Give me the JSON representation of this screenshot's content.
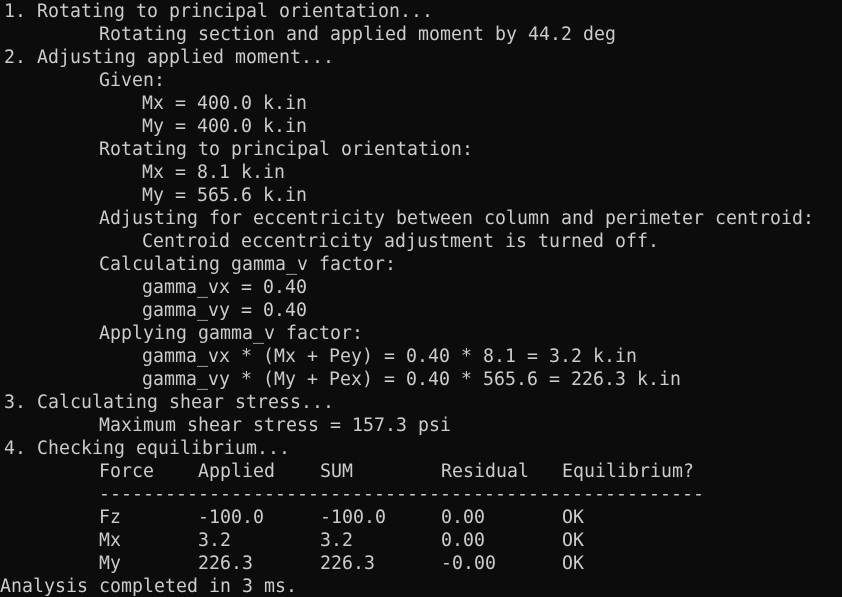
{
  "console": {
    "step1": {
      "title": "1. Rotating to principal orientation...",
      "detail": "Rotating section and applied moment by 44.2 deg"
    },
    "step2": {
      "title": "2. Adjusting applied moment...",
      "given_label": "Given:",
      "given_mx": "Mx = 400.0 k.in",
      "given_my": "My = 400.0 k.in",
      "rotating_label": "Rotating to principal orientation:",
      "rot_mx": "Mx = 8.1 k.in",
      "rot_my": "My = 565.6 k.in",
      "ecc_label": "Adjusting for eccentricity between column and perimeter centroid:",
      "ecc_detail": "Centroid eccentricity adjustment is turned off.",
      "gamma_label": "Calculating gamma_v factor:",
      "gamma_vx": "gamma_vx = 0.40",
      "gamma_vy": "gamma_vy = 0.40",
      "apply_label": "Applying gamma_v factor:",
      "apply_vx": "gamma_vx * (Mx + Pey) = 0.40 * 8.1 = 3.2 k.in",
      "apply_vy": "gamma_vy * (My + Pex) = 0.40 * 565.6 = 226.3 k.in"
    },
    "step3": {
      "title": "3. Calculating shear stress...",
      "detail": "Maximum shear stress = 157.3 psi"
    },
    "step4": {
      "title": "4. Checking equilibrium...",
      "headers": [
        "Force",
        "Applied",
        "SUM",
        "Residual",
        "Equilibrium?"
      ],
      "separator": "-------------------------------------------------------",
      "rows": [
        [
          "Fz",
          "-100.0",
          "-100.0",
          "0.00",
          "OK"
        ],
        [
          "Mx",
          "3.2",
          "3.2",
          "0.00",
          "OK"
        ],
        [
          "My",
          "226.3",
          "226.3",
          "-0.00",
          "OK"
        ]
      ]
    },
    "footer": "Analysis completed in 3 ms."
  }
}
